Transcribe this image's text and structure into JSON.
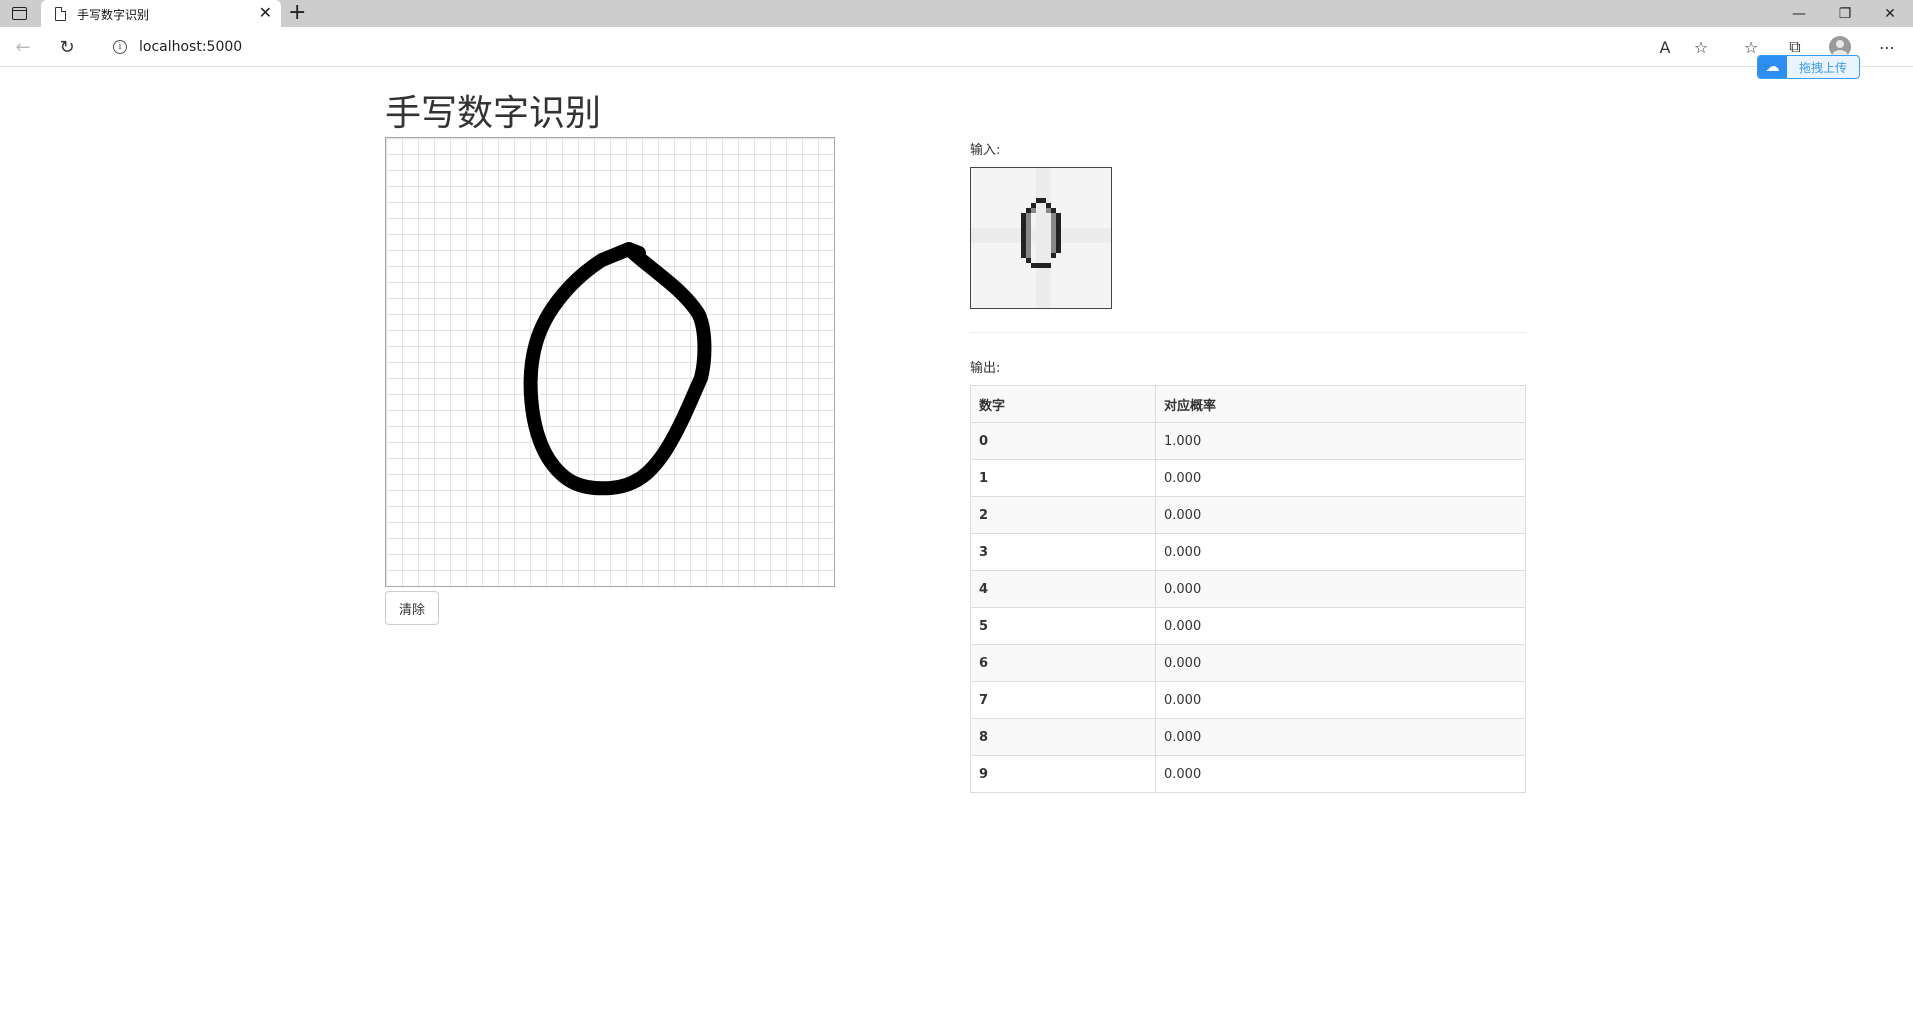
{
  "browser": {
    "tab_title": "手写数字识别",
    "tab_close": "✕",
    "new_tab": "+",
    "url": "localhost:5000",
    "window_controls": {
      "minimize": "—",
      "restore": "❐",
      "close": "✕"
    },
    "extension_badge": {
      "label": "拖拽上传",
      "icon": "cloud-icon"
    }
  },
  "page": {
    "title": "手写数字识别",
    "clear_button": "清除",
    "input_label": "输入:",
    "output_label": "输出:"
  },
  "results": {
    "headers": [
      "数字",
      "对应概率"
    ],
    "rows": [
      {
        "digit": "0",
        "prob": "1.000"
      },
      {
        "digit": "1",
        "prob": "0.000"
      },
      {
        "digit": "2",
        "prob": "0.000"
      },
      {
        "digit": "3",
        "prob": "0.000"
      },
      {
        "digit": "4",
        "prob": "0.000"
      },
      {
        "digit": "5",
        "prob": "0.000"
      },
      {
        "digit": "6",
        "prob": "0.000"
      },
      {
        "digit": "7",
        "prob": "0.000"
      },
      {
        "digit": "8",
        "prob": "0.000"
      },
      {
        "digit": "9",
        "prob": "0.000"
      }
    ]
  },
  "colors": {
    "stroke": "#000000",
    "accent_badge": "#2b8ef0"
  }
}
